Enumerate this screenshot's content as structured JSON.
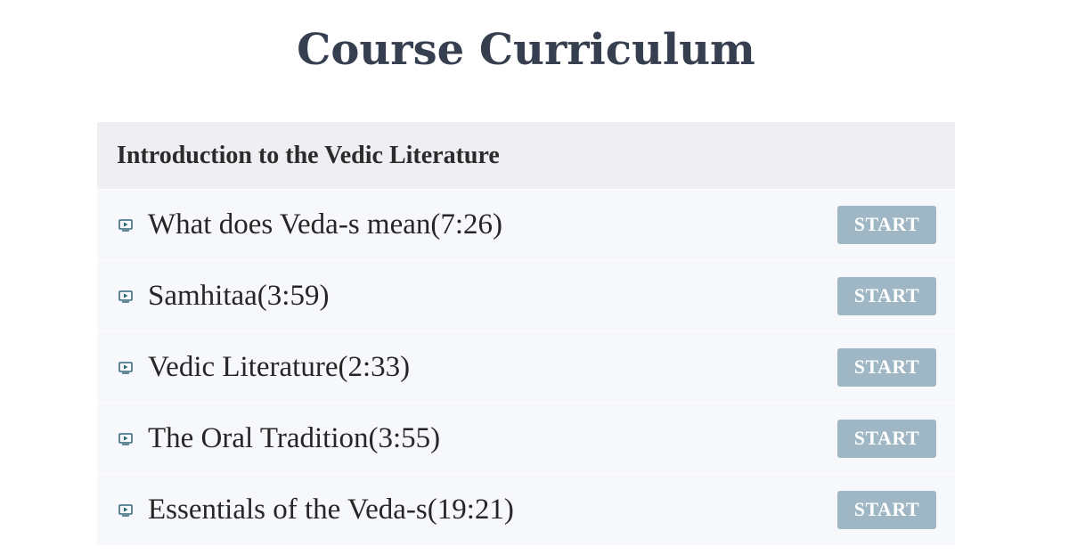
{
  "page": {
    "title": "Course Curriculum"
  },
  "section": {
    "title": "Introduction to the Vedic Literature",
    "lectures": [
      {
        "title": "What does Veda-s mean(7:26)",
        "icon": "video-play-icon",
        "button_label": "START"
      },
      {
        "title": "Samhitaa(3:59)",
        "icon": "video-play-icon",
        "button_label": "START"
      },
      {
        "title": "Vedic Literature(2:33)",
        "icon": "video-play-icon",
        "button_label": "START"
      },
      {
        "title": "The Oral Tradition(3:55)",
        "icon": "video-play-icon",
        "button_label": "START"
      },
      {
        "title": "Essentials of the Veda-s(19:21)",
        "icon": "video-play-icon",
        "button_label": "START"
      }
    ]
  },
  "colors": {
    "title_text": "#353f4f",
    "section_header_bg": "#efeff3",
    "row_bg": "#f7f8fb",
    "start_button_bg": "#9fb6c4",
    "icon_color": "#2f6577"
  }
}
